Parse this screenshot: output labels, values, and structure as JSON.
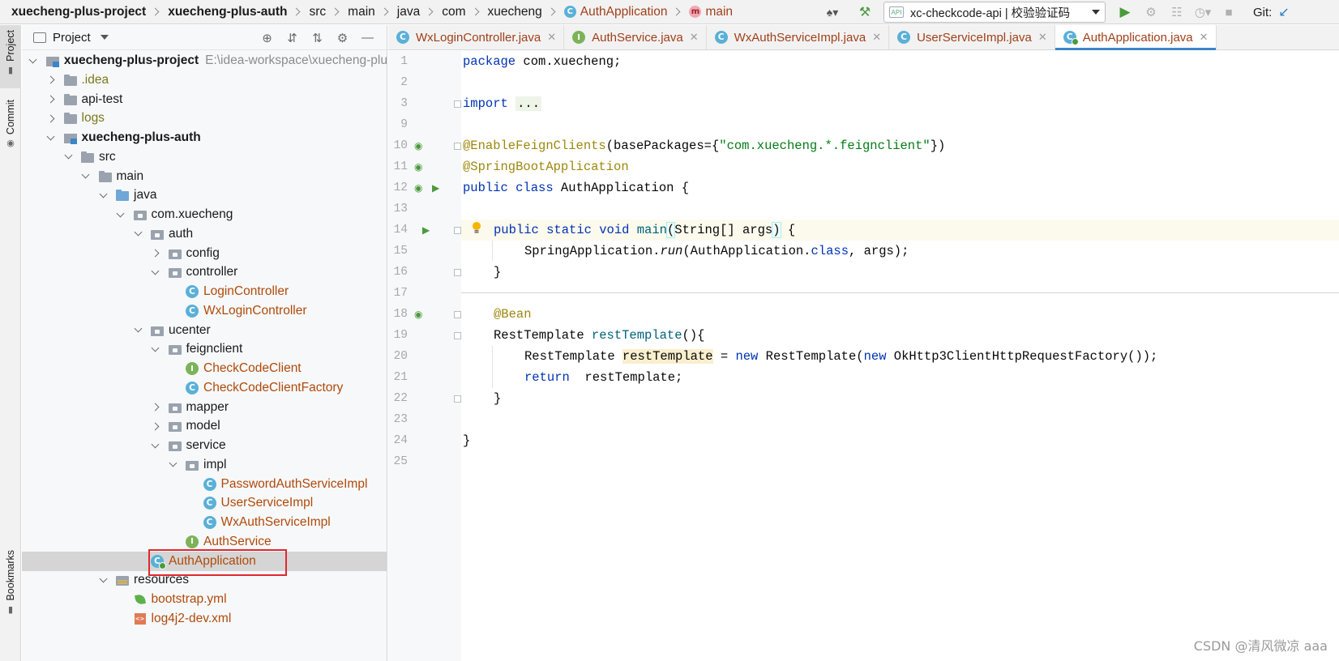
{
  "breadcrumbs": [
    {
      "label": "xuecheng-plus-project",
      "bold": true
    },
    {
      "label": "xuecheng-plus-auth",
      "bold": true
    },
    {
      "label": "src"
    },
    {
      "label": "main"
    },
    {
      "label": "java"
    },
    {
      "label": "com"
    },
    {
      "label": "xuecheng"
    },
    {
      "label": "AuthApplication",
      "icon": "class-icon",
      "red": true
    },
    {
      "label": "main",
      "icon": "method-icon",
      "red": true
    }
  ],
  "toolbar": {
    "run_config": "xc-checkcode-api | 校验验证码",
    "git_label": "Git:"
  },
  "side_strip": {
    "project": "Project",
    "commit": "Commit",
    "bookmarks": "Bookmarks"
  },
  "project_panel": {
    "title": "Project",
    "tree": [
      {
        "label": "xuecheng-plus-project",
        "icon": "module",
        "arrow": "down",
        "indent": 0,
        "bold": true,
        "path": "E:\\idea-workspace\\xuecheng-plu"
      },
      {
        "label": ".idea",
        "icon": "folder",
        "arrow": "right",
        "indent": 1,
        "style": "olive"
      },
      {
        "label": "api-test",
        "icon": "folder",
        "arrow": "right",
        "indent": 1
      },
      {
        "label": "logs",
        "icon": "folder",
        "arrow": "right",
        "indent": 1,
        "style": "olive"
      },
      {
        "label": "xuecheng-plus-auth",
        "icon": "module",
        "arrow": "down",
        "indent": 1,
        "bold": true
      },
      {
        "label": "src",
        "icon": "folder",
        "arrow": "down",
        "indent": 2
      },
      {
        "label": "main",
        "icon": "folder",
        "arrow": "down",
        "indent": 3
      },
      {
        "label": "java",
        "icon": "folder-blue",
        "arrow": "down",
        "indent": 4
      },
      {
        "label": "com.xuecheng",
        "icon": "package",
        "arrow": "down",
        "indent": 5
      },
      {
        "label": "auth",
        "icon": "package",
        "arrow": "down",
        "indent": 6
      },
      {
        "label": "config",
        "icon": "package",
        "arrow": "right",
        "indent": 7
      },
      {
        "label": "controller",
        "icon": "package",
        "arrow": "down",
        "indent": 7
      },
      {
        "label": "LoginController",
        "icon": "class",
        "arrow": "none",
        "indent": 8,
        "style": "red"
      },
      {
        "label": "WxLoginController",
        "icon": "class",
        "arrow": "none",
        "indent": 8,
        "style": "red"
      },
      {
        "label": "ucenter",
        "icon": "package",
        "arrow": "down",
        "indent": 6
      },
      {
        "label": "feignclient",
        "icon": "package",
        "arrow": "down",
        "indent": 7
      },
      {
        "label": "CheckCodeClient",
        "icon": "interface",
        "arrow": "none",
        "indent": 8,
        "style": "red"
      },
      {
        "label": "CheckCodeClientFactory",
        "icon": "class",
        "arrow": "none",
        "indent": 8,
        "style": "red"
      },
      {
        "label": "mapper",
        "icon": "package",
        "arrow": "right",
        "indent": 7
      },
      {
        "label": "model",
        "icon": "package",
        "arrow": "right",
        "indent": 7
      },
      {
        "label": "service",
        "icon": "package",
        "arrow": "down",
        "indent": 7
      },
      {
        "label": "impl",
        "icon": "package",
        "arrow": "down",
        "indent": 8
      },
      {
        "label": "PasswordAuthServiceImpl",
        "icon": "class",
        "arrow": "none",
        "indent": 9,
        "style": "red"
      },
      {
        "label": "UserServiceImpl",
        "icon": "class",
        "arrow": "none",
        "indent": 9,
        "style": "red"
      },
      {
        "label": "WxAuthServiceImpl",
        "icon": "class",
        "arrow": "none",
        "indent": 9,
        "style": "red"
      },
      {
        "label": "AuthService",
        "icon": "interface",
        "arrow": "none",
        "indent": 8,
        "style": "red"
      },
      {
        "label": "AuthApplication",
        "icon": "app",
        "arrow": "none",
        "indent": 6,
        "style": "red",
        "selected": true
      },
      {
        "label": "resources",
        "icon": "res",
        "arrow": "down",
        "indent": 4
      },
      {
        "label": "bootstrap.yml",
        "icon": "yml",
        "arrow": "none",
        "indent": 5,
        "style": "red"
      },
      {
        "label": "log4j2-dev.xml",
        "icon": "xml",
        "arrow": "none",
        "indent": 5,
        "style": "red"
      }
    ]
  },
  "editor": {
    "tabs": [
      {
        "label": "WxLoginController.java",
        "icon": "class"
      },
      {
        "label": "AuthService.java",
        "icon": "interface"
      },
      {
        "label": "WxAuthServiceImpl.java",
        "icon": "class"
      },
      {
        "label": "UserServiceImpl.java",
        "icon": "class"
      },
      {
        "label": "AuthApplication.java",
        "icon": "app",
        "active": true
      }
    ],
    "line_numbers": [
      "1",
      "2",
      "3",
      "9",
      "10",
      "11",
      "12",
      "13",
      "14",
      "15",
      "16",
      "17",
      "18",
      "19",
      "20",
      "21",
      "22",
      "23",
      "24",
      "25"
    ]
  },
  "watermark": "CSDN @清风微凉 aaa",
  "colors": {
    "accent": "#3a86c8",
    "keyword": "#0033b3",
    "annotation": "#9e880d",
    "string": "#067d17",
    "modified_file": "#b04a0a",
    "highlight_box": "#e0282e"
  }
}
